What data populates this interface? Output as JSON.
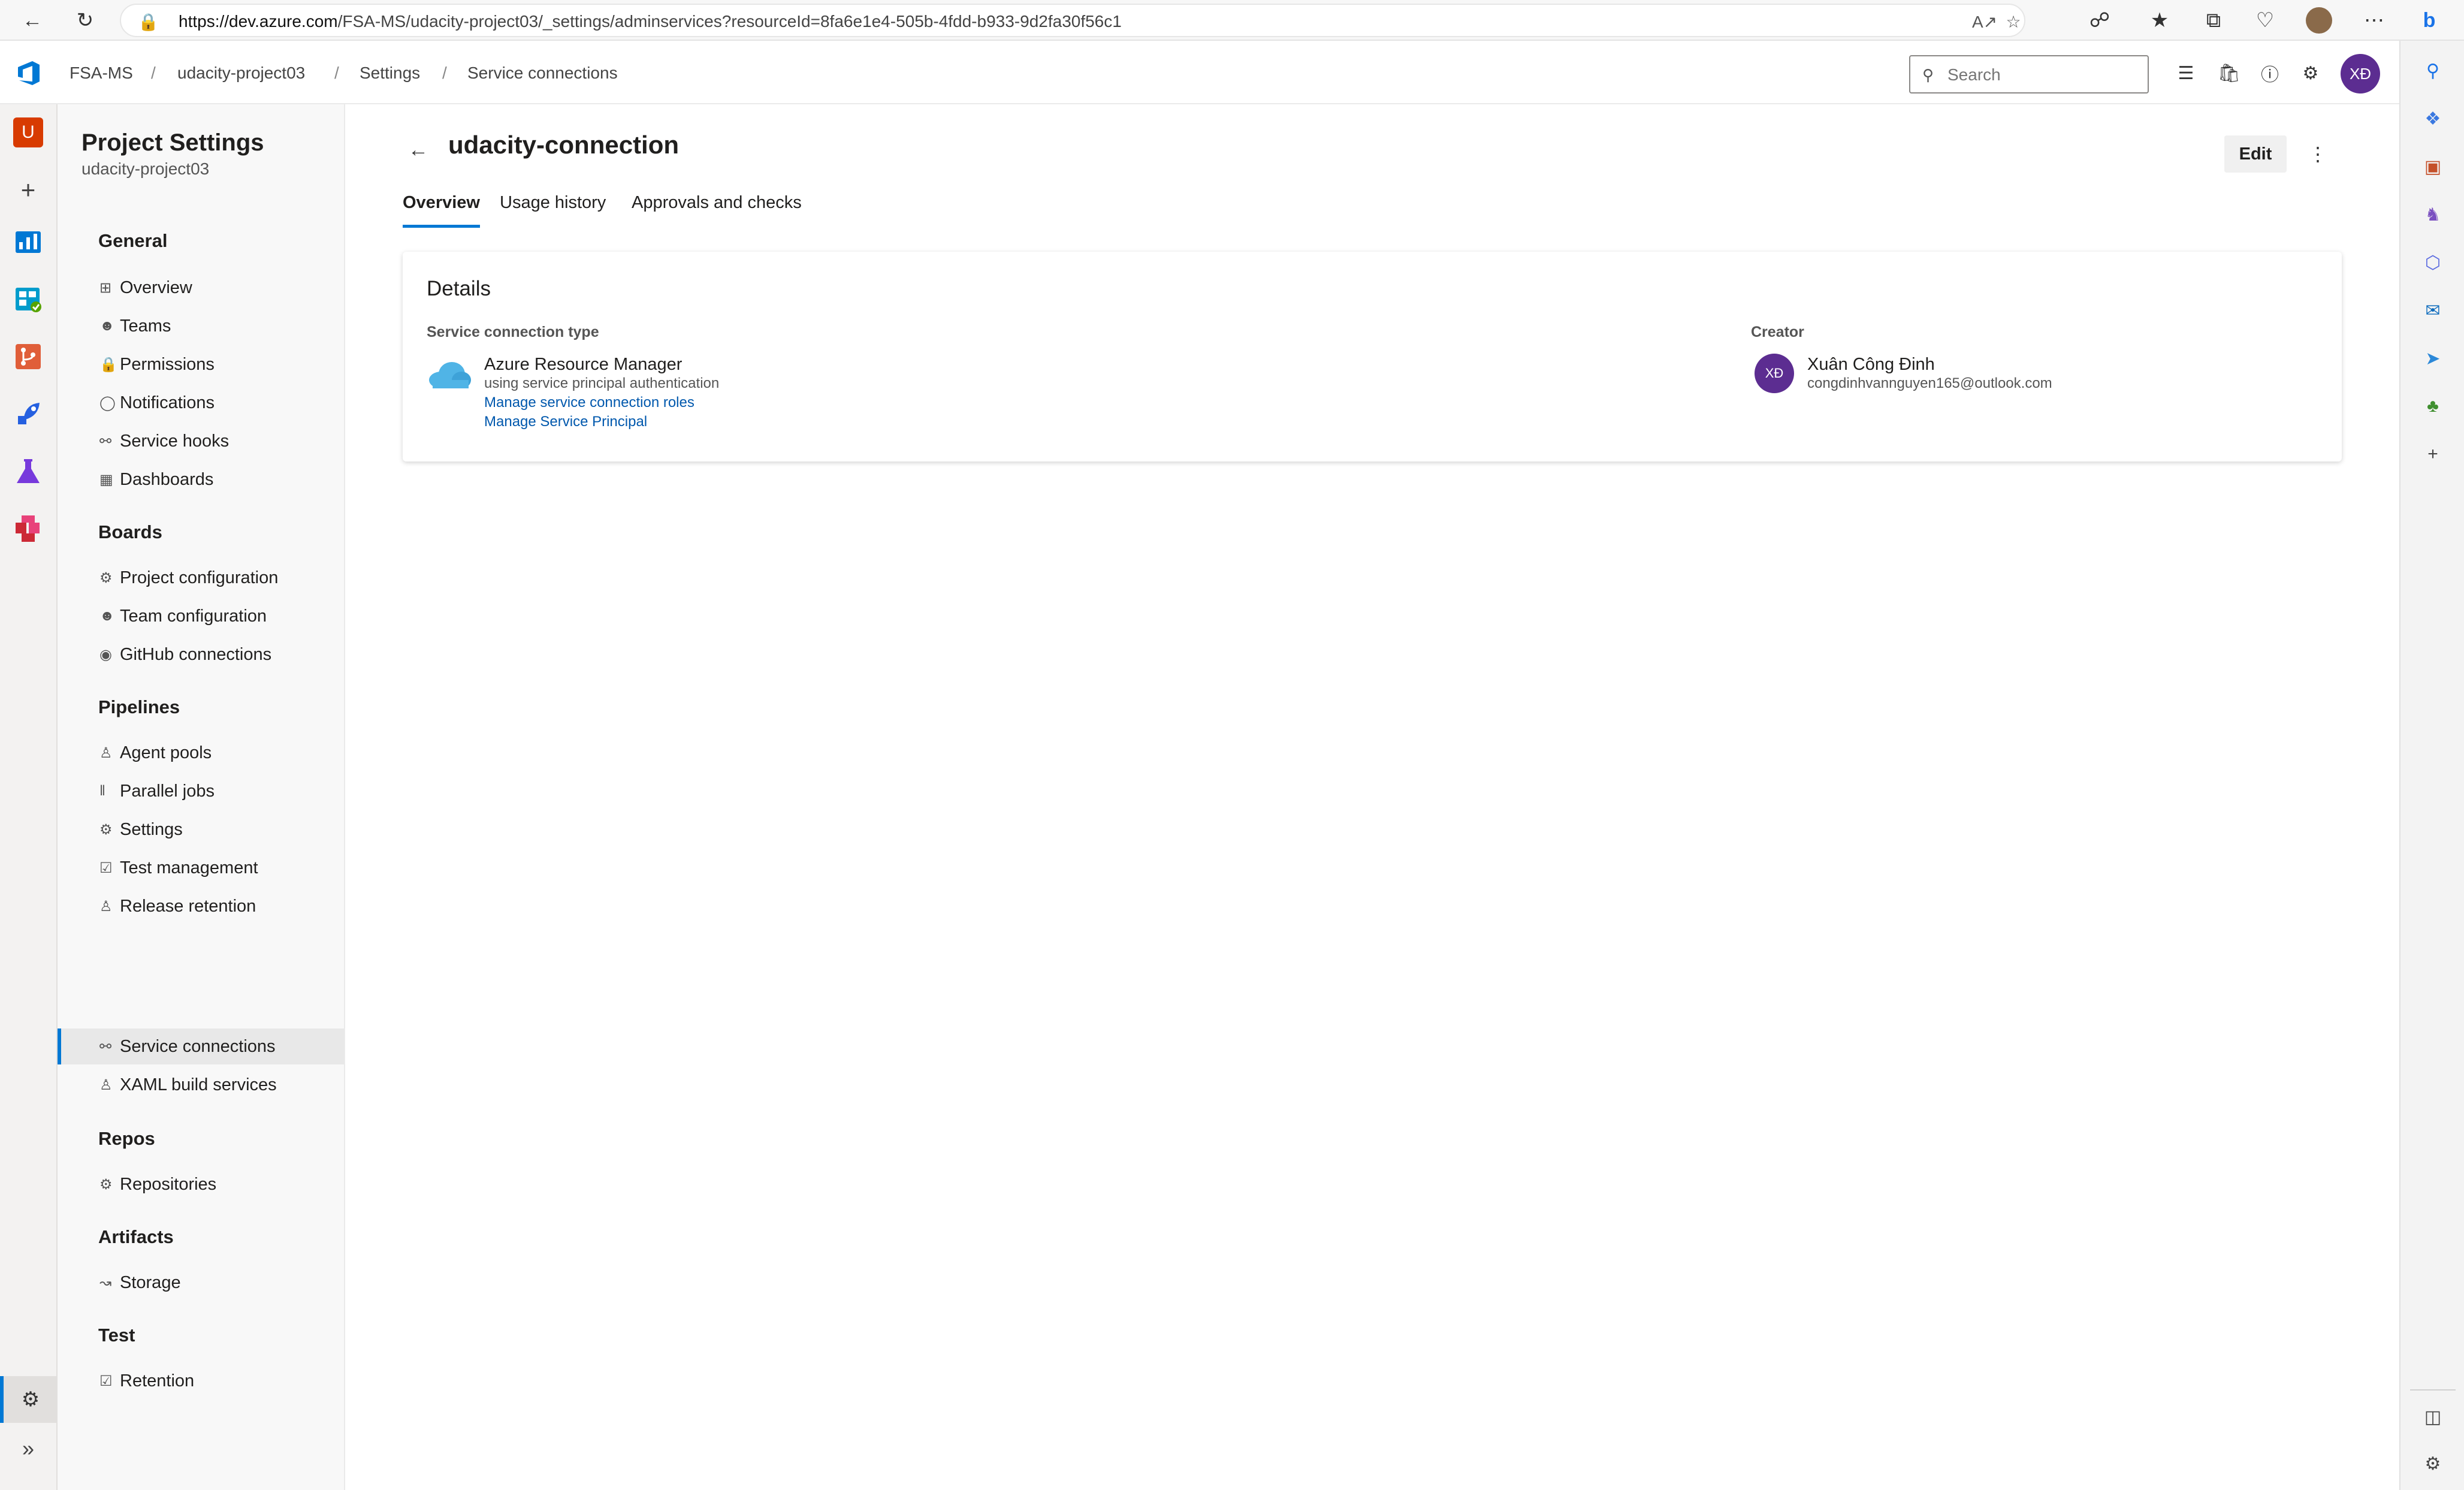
{
  "browser": {
    "url_host": "https://dev.azure.com",
    "url_path": "/FSA-MS/udacity-project03/_settings/adminservices?resourceId=8fa6e1e4-505b-4fdd-b933-9d2fa30f56c1",
    "icons": [
      "back-icon",
      "refresh-icon",
      "lock-icon",
      "read-aloud-icon",
      "favorite-star-icon",
      "extensions-icon",
      "favorites-icon",
      "collections-icon",
      "health-icon",
      "profile-icon",
      "more-icon",
      "bing-icon"
    ]
  },
  "header": {
    "breadcrumbs": [
      "FSA-MS",
      "udacity-project03",
      "Settings",
      "Service connections"
    ],
    "breadcrumb_separator": "/",
    "search_placeholder": "Search",
    "user_initials": "XĐ"
  },
  "app_rail": {
    "project_initial": "U",
    "items": [
      "overview",
      "boards",
      "repos",
      "pipelines",
      "test-plans",
      "artifacts"
    ],
    "colors": {
      "project": "#d83b01",
      "accent": "#0078d4"
    }
  },
  "settings_nav": {
    "title": "Project Settings",
    "subtitle": "udacity-project03",
    "sections": [
      {
        "label": "General",
        "items": [
          "Overview",
          "Teams",
          "Permissions",
          "Notifications",
          "Service hooks",
          "Dashboards"
        ]
      },
      {
        "label": "Boards",
        "items": [
          "Project configuration",
          "Team configuration",
          "GitHub connections"
        ]
      },
      {
        "label": "Pipelines",
        "items": [
          "Agent pools",
          "Parallel jobs",
          "Settings",
          "Test management",
          "Release retention",
          "Service connections",
          "XAML build services"
        ]
      },
      {
        "label": "Repos",
        "items": [
          "Repositories"
        ]
      },
      {
        "label": "Artifacts",
        "items": [
          "Storage"
        ]
      },
      {
        "label": "Test",
        "items": [
          "Retention"
        ]
      }
    ],
    "selected_item": "Service connections"
  },
  "main": {
    "title": "udacity-connection",
    "edit_label": "Edit",
    "tabs": [
      {
        "label": "Overview",
        "active": true
      },
      {
        "label": "Usage history",
        "active": false
      },
      {
        "label": "Approvals and checks",
        "active": false
      }
    ],
    "details": {
      "heading": "Details",
      "type_label": "Service connection type",
      "type_name": "Azure Resource Manager",
      "type_desc": "using service principal authentication",
      "link_roles": "Manage service connection roles",
      "link_principal": "Manage Service Principal",
      "creator_label": "Creator",
      "creator_initials": "XĐ",
      "creator_name": "Xuân Công Đinh",
      "creator_email": "congdinhvannguyen165@outlook.com"
    }
  },
  "colors": {
    "brand": "#0078d4",
    "avatar": "#5c2d91",
    "link": "#0058ad"
  }
}
